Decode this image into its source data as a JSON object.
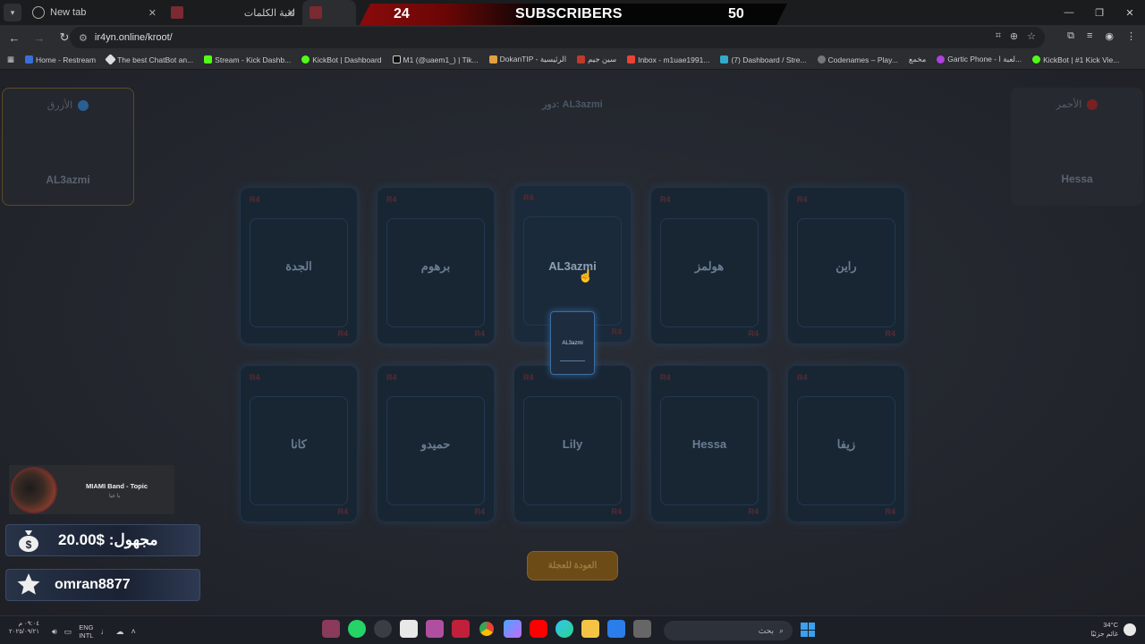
{
  "browser": {
    "tabs": [
      {
        "label": "New tab",
        "active": false
      },
      {
        "label": "لعبة الكلمات",
        "active": false
      },
      {
        "label": "",
        "active": true
      }
    ],
    "url": "ir4yn.online/kroot/",
    "bookmarks": [
      "Home - Restream",
      "The best ChatBot an...",
      "Stream - Kick Dashb...",
      "KickBot | Dashboard",
      "M1 (@uaem1_) | Tik...",
      "DokanTIP - الرئيسية",
      "سين جيم",
      "Inbox - m1uae1991...",
      "(7) Dashboard / Stre...",
      "Codenames – Play...",
      "مخمع",
      "Gartic Phone - لعبة ا...",
      "KickBot | #1 Kick Vie..."
    ]
  },
  "overlay": {
    "left_number": "24",
    "label": "SUBSCRIBERS",
    "right_number": "50"
  },
  "game": {
    "turn_label": "دور: AL3azmi",
    "blue_team": {
      "label": "الأزرق",
      "player": "AL3azmi",
      "color": "#3a7bd5"
    },
    "red_team": {
      "label": "الأحمر",
      "player": "Hessa",
      "color": "#c0392b"
    },
    "cards": [
      {
        "word": "الجدة"
      },
      {
        "word": "برهوم"
      },
      {
        "word": "AL3azmi"
      },
      {
        "word": "هولمز"
      },
      {
        "word": "راين"
      },
      {
        "word": "كانا"
      },
      {
        "word": "حميدو"
      },
      {
        "word": "Lily"
      },
      {
        "word": "Hessa"
      },
      {
        "word": "زيفا"
      }
    ],
    "card_logo": "R4",
    "dragged_card": "AL3azmi",
    "back_button": "العودة للعجلة"
  },
  "stream": {
    "now_playing_title": "MIAMI Band - Topic",
    "now_playing_sub": "يا عيا",
    "donation": "مجهول: $20.00",
    "follower": "omran8877"
  },
  "taskbar": {
    "time": "٠٩:٠٤ م",
    "date": "٢٠٢٥/٠٩/٢١",
    "lang_top": "ENG",
    "lang_bottom": "INTL",
    "search_placeholder": "بحث",
    "weather_temp": "34°C",
    "weather_desc": "غائم جزئيًا"
  }
}
